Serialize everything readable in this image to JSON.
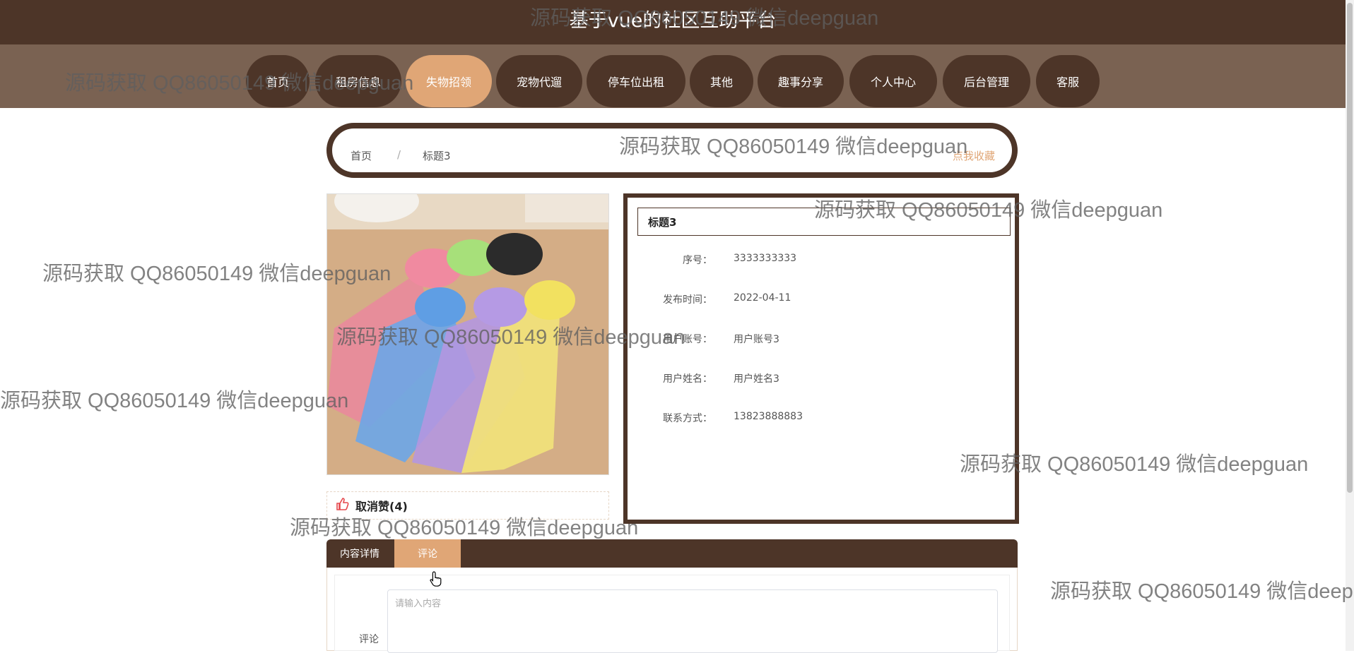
{
  "header": {
    "site_title": "基于vue的社区互助平台"
  },
  "nav": {
    "items": [
      {
        "label": "首页"
      },
      {
        "label": "租房信息"
      },
      {
        "label": "失物招领"
      },
      {
        "label": "宠物代遛"
      },
      {
        "label": "停车位出租"
      },
      {
        "label": "其他"
      },
      {
        "label": "趣事分享"
      },
      {
        "label": "个人中心"
      },
      {
        "label": "后台管理"
      },
      {
        "label": "客服"
      }
    ],
    "active_index": 2
  },
  "breadcrumb": {
    "home": "首页",
    "separator": "/",
    "current": "标题3",
    "collect_label": "点我收藏"
  },
  "like": {
    "label": "取消赞(4)"
  },
  "detail": {
    "title": "标题3",
    "fields": [
      {
        "label": "序号：",
        "value": "3333333333"
      },
      {
        "label": "发布时间：",
        "value": "2022-04-11"
      },
      {
        "label": "用户账号：",
        "value": "用户账号3"
      },
      {
        "label": "用户姓名：",
        "value": "用户姓名3"
      },
      {
        "label": "联系方式：",
        "value": "13823888883"
      }
    ]
  },
  "tabs": {
    "items": [
      {
        "label": "内容详情"
      },
      {
        "label": "评论"
      }
    ],
    "active_index": 1
  },
  "comment": {
    "label": "评论",
    "placeholder": "请输入内容"
  },
  "watermark": {
    "text": "源码获取 QQ86050149 微信deepguan"
  },
  "colors": {
    "primary": "#4d3528",
    "accent": "#e0a676",
    "nav_bg": "#7a6252"
  }
}
